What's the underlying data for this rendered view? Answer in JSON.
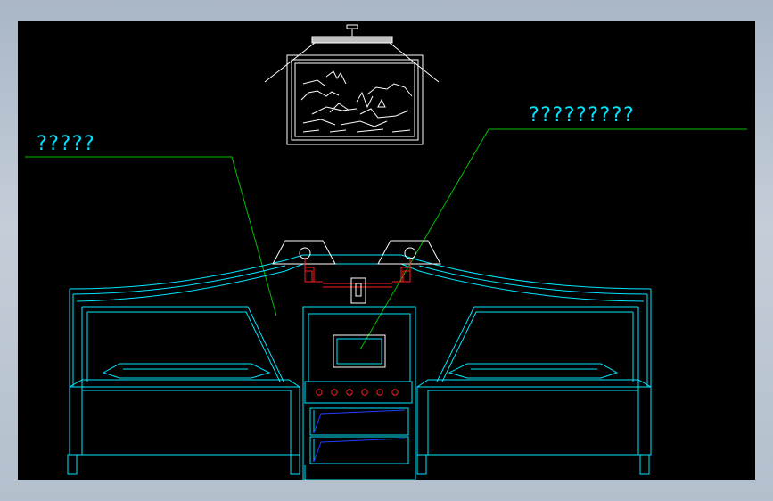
{
  "drawing": {
    "labels": [
      {
        "text": "?????"
      },
      {
        "text": "?????????"
      }
    ],
    "colors": {
      "background": "#000000",
      "furniture": "#00e5ff",
      "callout": "#00c000",
      "white": "#ffffff",
      "red": "#ff2020",
      "blue": "#2040ff",
      "frame": "#b3bfcc"
    }
  }
}
